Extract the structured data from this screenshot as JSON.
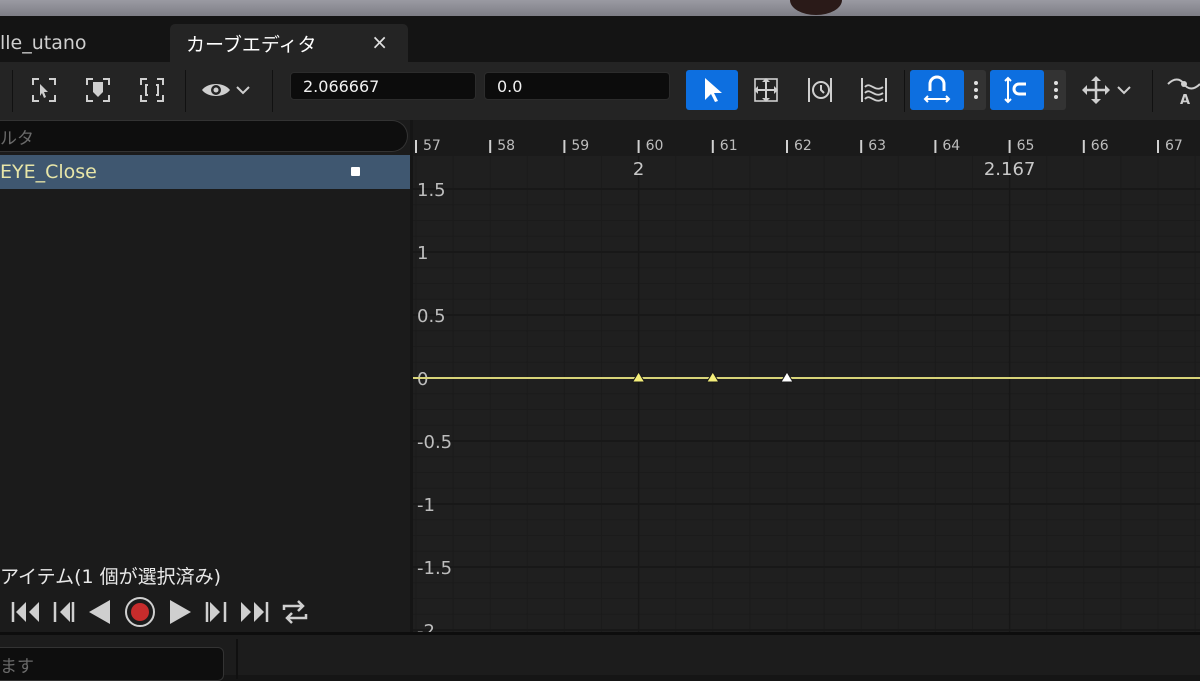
{
  "tabs": {
    "asset_tab": "lle_utano",
    "curve_editor_tab": "カーブエディタ",
    "close_glyph": "×"
  },
  "toolbar": {
    "time_value": "2.066667",
    "curve_value": "0.0",
    "icons": [
      "select-keys-icon",
      "frame-selection-icon",
      "frame-all-icon",
      "view-options-icon",
      "chevron-down-icon",
      "select-tool-icon",
      "transform-tool-icon",
      "retime-tool-icon",
      "multi-scale-tool-icon",
      "snap-time-icon",
      "more-options-icon",
      "snap-value-icon",
      "more-options-icon",
      "axis-snap-icon",
      "chevron-down-icon",
      "tangent-auto-icon"
    ],
    "accent_color": "#0d6fe0"
  },
  "left_panel": {
    "filter_placeholder": "ルタ",
    "curves": [
      {
        "label": "EYE_Close"
      }
    ],
    "item_count": "アイテム(1 個が選択済み)",
    "transport_icons": [
      "jump-to-start-icon",
      "step-back-icon",
      "play-reverse-icon",
      "record-icon",
      "play-icon",
      "step-forward-icon",
      "jump-to-end-icon",
      "loop-icon"
    ]
  },
  "graph": {
    "frame_ticks": [
      "57",
      "58",
      "59",
      "60",
      "61",
      "62",
      "63",
      "64",
      "65",
      "66",
      "67"
    ],
    "time_labels": [
      "2",
      "2.167"
    ],
    "y_labels": [
      "1.5",
      "1",
      "0.5",
      "0",
      "-0.5",
      "-1",
      "-1.5",
      "-2"
    ],
    "curve_color": "#d8d479",
    "keys": [
      {
        "frame": 60,
        "value": 0,
        "selected": true
      },
      {
        "frame": 61,
        "value": 0,
        "selected": true
      },
      {
        "frame": 62,
        "value": 0,
        "selected": false
      }
    ]
  },
  "bottom": {
    "search_placeholder": "ます"
  }
}
